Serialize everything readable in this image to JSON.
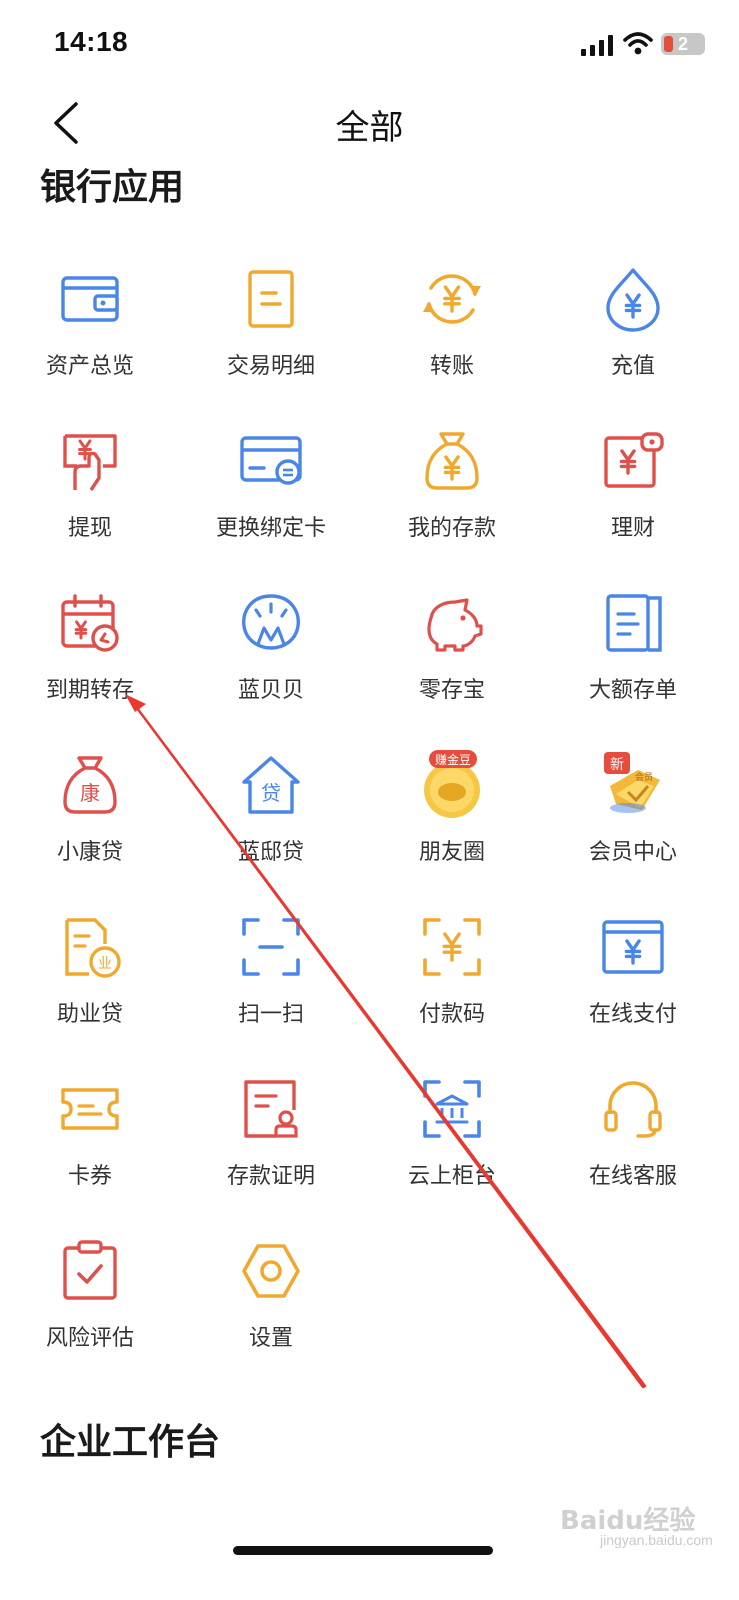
{
  "status_bar": {
    "time": "14:18",
    "battery_level": "2"
  },
  "nav": {
    "title": "全部"
  },
  "sections": {
    "bank_apps": "银行应用",
    "enterprise": "企业工作台"
  },
  "apps": [
    {
      "label": "资产总览",
      "icon": "wallet-icon",
      "color": "#4a86e8"
    },
    {
      "label": "交易明细",
      "icon": "document-list-icon",
      "color": "#f0a92e"
    },
    {
      "label": "转账",
      "icon": "yuan-transfer-icon",
      "color": "#f0a92e"
    },
    {
      "label": "充值",
      "icon": "yuan-drop-icon",
      "color": "#4a86e8"
    },
    {
      "label": "提现",
      "icon": "withdraw-hand-icon",
      "color": "#e0504a"
    },
    {
      "label": "更换绑定卡",
      "icon": "bank-card-icon",
      "color": "#4a86e8"
    },
    {
      "label": "我的存款",
      "icon": "money-bag-icon",
      "color": "#f0a92e"
    },
    {
      "label": "理财",
      "icon": "wealth-tag-icon",
      "color": "#e0504a"
    },
    {
      "label": "到期转存",
      "icon": "calendar-renew-icon",
      "color": "#e0504a"
    },
    {
      "label": "蓝贝贝",
      "icon": "shell-icon",
      "color": "#4a86e8"
    },
    {
      "label": "零存宝",
      "icon": "piggy-bank-icon",
      "color": "#e0504a"
    },
    {
      "label": "大额存单",
      "icon": "certificate-icon",
      "color": "#4a86e8"
    },
    {
      "label": "小康贷",
      "icon": "kang-bag-icon",
      "color": "#e0504a",
      "glyph": "康"
    },
    {
      "label": "蓝邸贷",
      "icon": "house-loan-icon",
      "color": "#4a86e8",
      "glyph": "贷"
    },
    {
      "label": "朋友圈",
      "icon": "gold-bean-icon",
      "color": "#f0a92e",
      "badge": "赚金豆"
    },
    {
      "label": "会员中心",
      "icon": "member-crown-icon",
      "color": "#f0a92e",
      "badge": "新",
      "sub": "会员"
    },
    {
      "label": "助业贷",
      "icon": "business-loan-icon",
      "color": "#f0a92e",
      "glyph": "业"
    },
    {
      "label": "扫一扫",
      "icon": "scan-icon",
      "color": "#4a86e8"
    },
    {
      "label": "付款码",
      "icon": "pay-code-icon",
      "color": "#f0a92e"
    },
    {
      "label": "在线支付",
      "icon": "online-pay-icon",
      "color": "#4a86e8"
    },
    {
      "label": "卡券",
      "icon": "coupon-icon",
      "color": "#f0a92e"
    },
    {
      "label": "存款证明",
      "icon": "deposit-proof-icon",
      "color": "#e0504a"
    },
    {
      "label": "云上柜台",
      "icon": "cloud-counter-icon",
      "color": "#4a86e8"
    },
    {
      "label": "在线客服",
      "icon": "headset-icon",
      "color": "#f0a92e"
    },
    {
      "label": "风险评估",
      "icon": "risk-clipboard-icon",
      "color": "#e0504a"
    },
    {
      "label": "设置",
      "icon": "settings-hex-icon",
      "color": "#f0a92e"
    }
  ],
  "annotation": {
    "color": "#e8382f"
  },
  "watermark": {
    "text": "Baidu经验",
    "sub": "jingyan.baidu.com"
  }
}
